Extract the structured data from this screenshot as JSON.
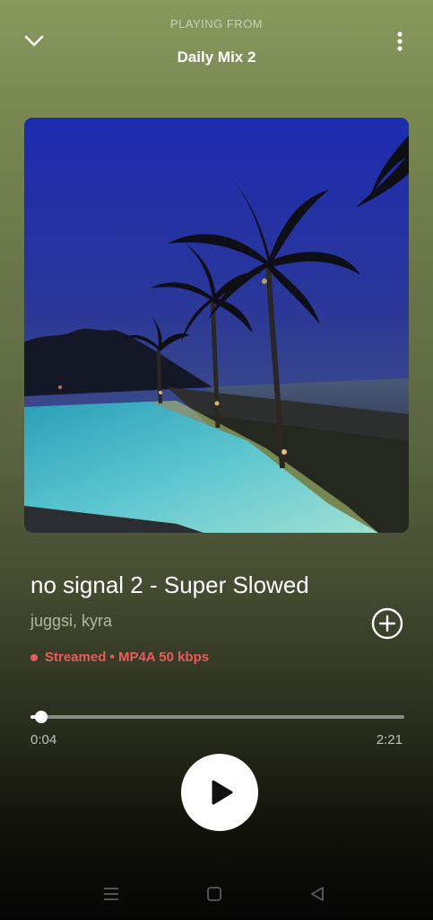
{
  "header": {
    "context_label": "PLAYING FROM",
    "playlist_name": "Daily Mix 2",
    "collapse_icon": "chevron-down-icon",
    "more_icon": "more-vertical-icon"
  },
  "track": {
    "title": "no signal 2 - Super Slowed",
    "artists": "juggsi, kyra",
    "stream_info": "Streamed • MP4A 50 kbps",
    "add_icon": "plus-circle-icon"
  },
  "playback": {
    "elapsed": "0:04",
    "duration": "2:21",
    "progress_fraction": 0.028,
    "state_icon": "play-icon"
  },
  "navbar": {
    "items": [
      "menu-icon",
      "home-icon",
      "back-icon"
    ]
  },
  "colors": {
    "accent_stream": "#f05a5a",
    "background_top": "#8a9a5e",
    "background_bottom": "#050505"
  }
}
